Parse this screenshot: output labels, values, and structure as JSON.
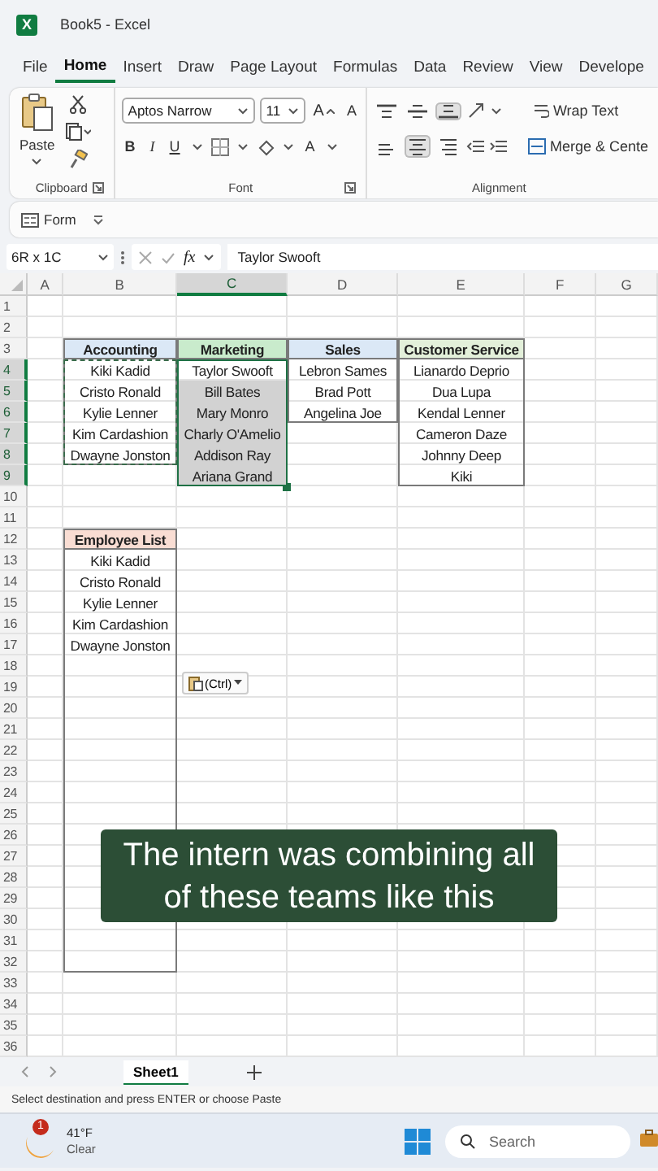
{
  "window": {
    "icon_letter": "X",
    "title": "Book5 - Excel"
  },
  "ribbon_tabs": [
    {
      "label": "File",
      "selected": false
    },
    {
      "label": "Home",
      "selected": true
    },
    {
      "label": "Insert",
      "selected": false
    },
    {
      "label": "Draw",
      "selected": false
    },
    {
      "label": "Page Layout",
      "selected": false
    },
    {
      "label": "Formulas",
      "selected": false
    },
    {
      "label": "Data",
      "selected": false
    },
    {
      "label": "Review",
      "selected": false
    },
    {
      "label": "View",
      "selected": false
    },
    {
      "label": "Develope",
      "selected": false
    }
  ],
  "ribbon": {
    "paste_label": "Paste",
    "font_name": "Aptos Narrow",
    "font_size": "11",
    "grow_font": "A",
    "shrink_font": "A",
    "bold": "B",
    "italic": "I",
    "underline": "U",
    "font_color": "A",
    "vertical_align": [
      {
        "kind": "top",
        "selected": false
      },
      {
        "kind": "middle",
        "selected": false
      },
      {
        "kind": "bottom",
        "selected": true
      }
    ],
    "horizontal_align": [
      {
        "kind": "left",
        "selected": false
      },
      {
        "kind": "center",
        "selected": true
      },
      {
        "kind": "right",
        "selected": false
      }
    ],
    "wrap_text": "Wrap Text",
    "merge": "Merge & Cente",
    "groups": [
      "Clipboard",
      "Font",
      "Alignment"
    ]
  },
  "form_bar": {
    "label": "Form"
  },
  "formula_bar": {
    "name_box": "6R x 1C",
    "function_label": "fx",
    "value": "Taylor Swooft"
  },
  "columns": [
    {
      "label": "A",
      "selected": false
    },
    {
      "label": "B",
      "selected": false
    },
    {
      "label": "C",
      "selected": true
    },
    {
      "label": "D",
      "selected": false
    },
    {
      "label": "E",
      "selected": false
    },
    {
      "label": "F",
      "selected": false
    },
    {
      "label": "G",
      "selected": false
    }
  ],
  "rows": [
    {
      "label": "1",
      "selected": false
    },
    {
      "label": "2",
      "selected": false
    },
    {
      "label": "3",
      "selected": false
    },
    {
      "label": "4",
      "selected": true
    },
    {
      "label": "5",
      "selected": true
    },
    {
      "label": "6",
      "selected": true
    },
    {
      "label": "7",
      "selected": true
    },
    {
      "label": "8",
      "selected": true
    },
    {
      "label": "9",
      "selected": true
    },
    {
      "label": "10",
      "selected": false
    },
    {
      "label": "11",
      "selected": false
    },
    {
      "label": "12",
      "selected": false
    },
    {
      "label": "13",
      "selected": false
    },
    {
      "label": "14",
      "selected": false
    },
    {
      "label": "15",
      "selected": false
    },
    {
      "label": "16",
      "selected": false
    },
    {
      "label": "17",
      "selected": false
    },
    {
      "label": "18",
      "selected": false
    },
    {
      "label": "19",
      "selected": false
    },
    {
      "label": "20",
      "selected": false
    },
    {
      "label": "21",
      "selected": false
    },
    {
      "label": "22",
      "selected": false
    },
    {
      "label": "23",
      "selected": false
    },
    {
      "label": "24",
      "selected": false
    },
    {
      "label": "25",
      "selected": false
    },
    {
      "label": "26",
      "selected": false
    },
    {
      "label": "27",
      "selected": false
    },
    {
      "label": "28",
      "selected": false
    },
    {
      "label": "29",
      "selected": false
    },
    {
      "label": "30",
      "selected": false
    },
    {
      "label": "31",
      "selected": false
    },
    {
      "label": "32",
      "selected": false
    },
    {
      "label": "33",
      "selected": false
    },
    {
      "label": "34",
      "selected": false
    },
    {
      "label": "35",
      "selected": false
    },
    {
      "label": "36",
      "selected": false
    }
  ],
  "tables": [
    {
      "header": "Accounting",
      "color": "#dbe8f6",
      "copy_marquee": true,
      "items": [
        "Kiki Kadid",
        "Cristo Ronald",
        "Kylie Lenner",
        "Kim Cardashion",
        "Dwayne Jonston"
      ]
    },
    {
      "header": "Marketing",
      "color": "#c9ebcc",
      "selection": true,
      "items": [
        {
          "text": "Taylor Swooft",
          "selected": false
        },
        {
          "text": "Bill Bates",
          "selected": true
        },
        {
          "text": "Mary Monro",
          "selected": true
        },
        {
          "text": "Charly O'Amelio",
          "selected": true
        },
        {
          "text": "Addison Ray",
          "selected": true
        },
        {
          "text": "Ariana Grand",
          "selected": true
        }
      ]
    },
    {
      "header": "Sales",
      "color": "#dbe8f6",
      "items": [
        "Lebron Sames",
        "Brad Pott",
        "Angelina Joe"
      ]
    },
    {
      "header": "Customer Service",
      "color": "#e3f0da",
      "items": [
        "Lianardo Deprio",
        "Dua Lupa",
        "Kendal Lenner",
        "Cameron Daze",
        "Johnny Deep",
        "Kiki"
      ]
    },
    {
      "header": "Employee List",
      "color": "#f9ddd3",
      "items": [
        "Kiki Kadid",
        "Cristo Ronald",
        "Kylie Lenner",
        "Kim Cardashion",
        "Dwayne Jonston"
      ]
    }
  ],
  "paste_options": {
    "label": "(Ctrl)"
  },
  "caption": "The intern was combining all of these teams like this",
  "sheet_tabs": [
    {
      "label": "Sheet1",
      "selected": true
    }
  ],
  "status_bar": "Select destination and press ENTER or choose Paste",
  "taskbar": {
    "weather_badge": "1",
    "temperature": "41°F",
    "condition": "Clear",
    "search_placeholder": "Search"
  }
}
